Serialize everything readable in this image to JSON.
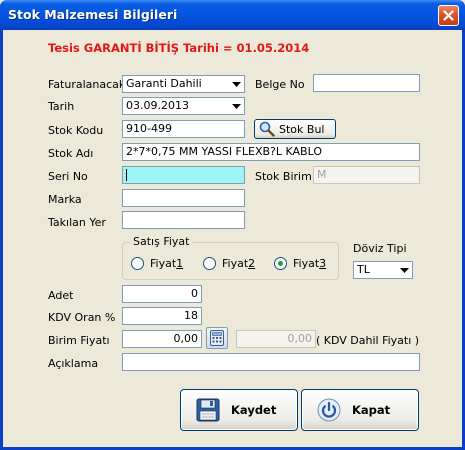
{
  "window": {
    "title": "Stok Malzemesi Bilgileri"
  },
  "warning": "Tesis GARANTİ BİTİŞ Tarihi = 01.05.2014",
  "labels": {
    "faturalanacak": "Faturalanacak",
    "belge_no": "Belge No",
    "tarih": "Tarih",
    "stok_kodu": "Stok Kodu",
    "stok_adi": "Stok Adı",
    "seri_no": "Seri No",
    "stok_birim": "Stok Birim",
    "marka": "Marka",
    "takilan_yer": "Takılan Yer",
    "doviz_tipi": "Döviz Tipi",
    "adet": "Adet",
    "kdv_oran": "KDV Oran %",
    "birim_fiyati": "Birim Fiyatı",
    "kdv_dahil_fiyati": "( KDV Dahil Fiyatı )",
    "aciklama": "Açıklama"
  },
  "fields": {
    "faturalanacak": "Garanti Dahili",
    "belge_no": "",
    "tarih": "03.09.2013",
    "stok_kodu": "910-499",
    "stok_adi": "2*7*0,75 MM YASSI FLEXB?L KABLO",
    "seri_no": "",
    "stok_birim": "M",
    "marka": "",
    "takilan_yer": "",
    "doviz_tipi": "TL",
    "adet": "0",
    "kdv_oran": "18",
    "birim_fiyati": "0,00",
    "kdv_dahil_fiyati": "0,00",
    "aciklama": ""
  },
  "satis_fiyat": {
    "legend": "Satış Fiyat",
    "options": [
      {
        "prefix": "Fiyat ",
        "key": "1",
        "selected": false
      },
      {
        "prefix": "Fiyat ",
        "key": "2",
        "selected": false
      },
      {
        "prefix": "Fiyat ",
        "key": "3",
        "selected": true
      }
    ]
  },
  "buttons": {
    "stok_bul": "Stok Bul",
    "kaydet": "Kaydet",
    "kapat": "Kapat"
  },
  "icons": {
    "close": "close-icon",
    "search": "magnifier-icon",
    "calculator": "calculator-icon",
    "save": "floppy-disk-icon",
    "power": "power-icon"
  },
  "colors": {
    "title_bar": "#0454e0",
    "warning_text": "#e01818",
    "focused_field": "#9ef3f5",
    "dialog_bg": "#ece9d8"
  }
}
